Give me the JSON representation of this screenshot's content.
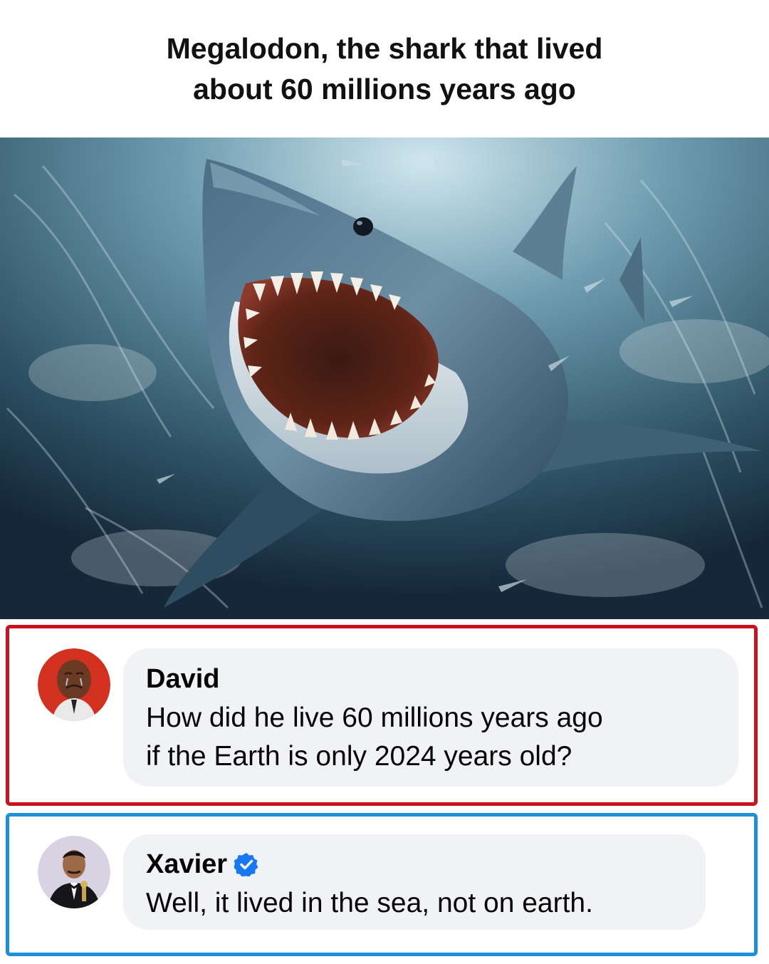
{
  "post": {
    "title_lines": [
      "Megalodon, the shark that lived",
      "about 60 millions years ago"
    ],
    "image": {
      "icon": "megalodon-illustration"
    }
  },
  "comments": [
    {
      "author": "David",
      "verified": false,
      "text_lines": [
        "How did he live 60 millions years ago",
        "if the Earth is only 2024 years old?"
      ],
      "highlight_color": "#c7141c",
      "avatar_icon": "crying-face-avatar"
    },
    {
      "author": "Xavier",
      "verified": true,
      "verified_icon": "verified-badge-icon",
      "text_lines": [
        "Well, it lived in the sea, not on earth."
      ],
      "highlight_color": "#1e90d6",
      "avatar_icon": "man-with-trophy-avatar"
    }
  ],
  "colors": {
    "bubble_background": "#f0f2f5",
    "verified_blue": "#1877f2"
  }
}
